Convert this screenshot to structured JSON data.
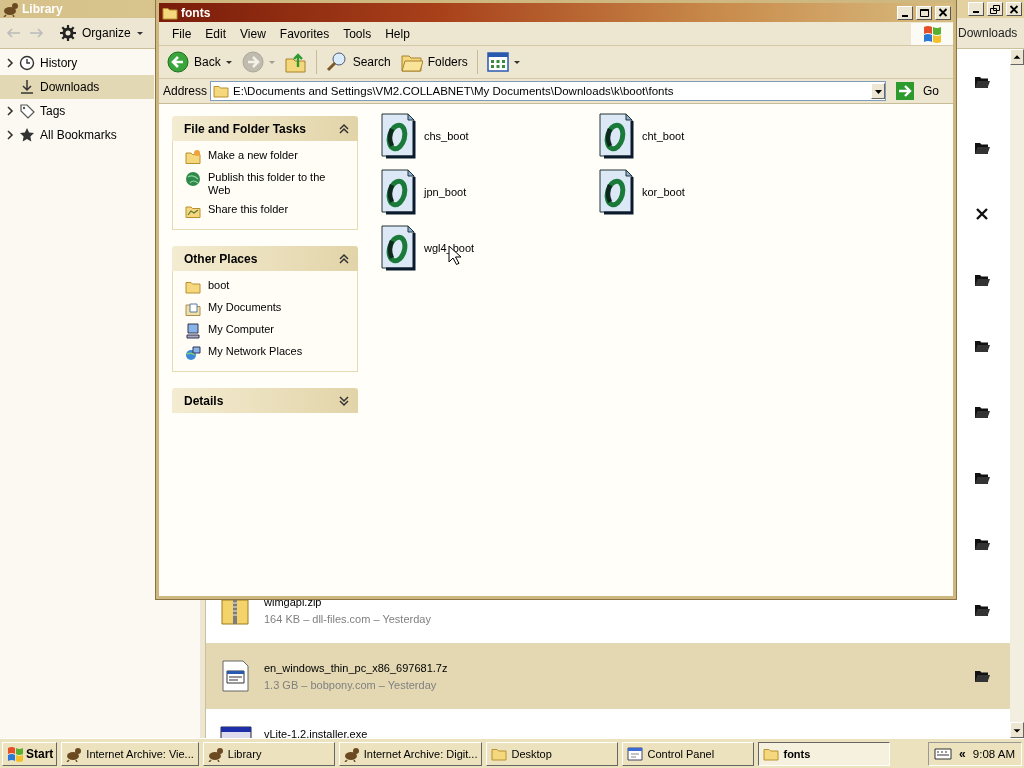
{
  "library": {
    "title": "Library",
    "organize": "Organize",
    "search": {
      "placeholder": "Downloads"
    },
    "sidebar": [
      {
        "label": "History",
        "expandable": true,
        "selected": false
      },
      {
        "label": "Downloads",
        "expandable": false,
        "selected": true
      },
      {
        "label": "Tags",
        "expandable": true,
        "selected": false
      },
      {
        "label": "All Bookmarks",
        "expandable": true,
        "selected": false
      }
    ],
    "downloads": [
      {
        "cancelled": false
      },
      {
        "cancelled": false
      },
      {
        "cancelled": true
      },
      {
        "cancelled": false
      },
      {
        "cancelled": false
      },
      {
        "cancelled": false
      },
      {
        "cancelled": false
      },
      {
        "cancelled": false
      },
      {
        "kind": "zip",
        "name": "wimgapi.zip",
        "details": "164 KB – dll-files.com – Yesterday",
        "cancelled": false,
        "selected": false
      },
      {
        "kind": "archive",
        "name": "en_windows_thin_pc_x86_697681.7z",
        "details": "1.3 GB – bobpony.com – Yesterday",
        "cancelled": false,
        "selected": true
      },
      {
        "kind": "installer",
        "name": "vLite-1.2.installer.exe",
        "selected": false
      }
    ]
  },
  "explorer": {
    "title": "fonts",
    "menu": [
      "File",
      "Edit",
      "View",
      "Favorites",
      "Tools",
      "Help"
    ],
    "toolbar": [
      {
        "kind": "back",
        "label": "Back",
        "disabled": false
      },
      {
        "kind": "forward",
        "disabled": true
      },
      {
        "kind": "up",
        "disabled": false
      },
      {
        "kind": "search",
        "label": "Search",
        "disabled": false
      },
      {
        "kind": "folders",
        "label": "Folders",
        "disabled": false
      },
      {
        "kind": "views",
        "disabled": false
      }
    ],
    "address": {
      "label": "Address",
      "value": "E:\\Documents and Settings\\VM2.COLLABNET\\My Documents\\Downloads\\k\\boot\\fonts",
      "go": "Go"
    },
    "task_sections": [
      {
        "title": "File and Folder Tasks",
        "expanded": true,
        "items": [
          {
            "kind": "new_folder",
            "label": "Make a new folder"
          },
          {
            "kind": "publish",
            "label": "Publish this folder to the Web"
          },
          {
            "kind": "share",
            "label": "Share this folder"
          }
        ]
      },
      {
        "title": "Other Places",
        "expanded": true,
        "items": [
          {
            "kind": "folder",
            "label": "boot"
          },
          {
            "kind": "documents",
            "label": "My Documents"
          },
          {
            "kind": "computer",
            "label": "My Computer"
          },
          {
            "kind": "network",
            "label": "My Network Places"
          }
        ]
      },
      {
        "title": "Details",
        "expanded": false
      }
    ],
    "files": [
      {
        "name": "chs_boot"
      },
      {
        "name": "cht_boot"
      },
      {
        "name": "jpn_boot"
      },
      {
        "name": "kor_boot"
      },
      {
        "name": "wgl4_boot"
      }
    ]
  },
  "taskbar": {
    "start": "Start",
    "tasks": [
      {
        "kind": "browser",
        "label": "Internet Archive: Vie...",
        "selected": false
      },
      {
        "kind": "browser",
        "label": "Library",
        "selected": false
      },
      {
        "kind": "browser",
        "label": "Internet Archive: Digit...",
        "selected": false
      },
      {
        "kind": "folder",
        "label": "Desktop",
        "selected": false
      },
      {
        "kind": "control_panel",
        "label": "Control Panel",
        "selected": false
      },
      {
        "kind": "folder",
        "label": "fonts",
        "selected": true
      }
    ],
    "clock": "9:08 AM",
    "tray_toggle": "«"
  }
}
